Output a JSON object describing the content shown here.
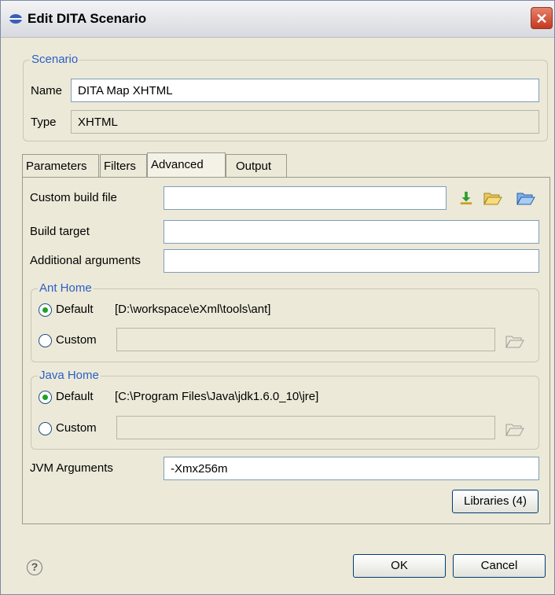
{
  "window": {
    "title": "Edit DITA Scenario"
  },
  "scenario": {
    "legend": "Scenario",
    "name_label": "Name",
    "name_value": "DITA Map XHTML",
    "type_label": "Type",
    "type_value": "XHTML"
  },
  "tabs": [
    {
      "label": "Parameters"
    },
    {
      "label": "Filters"
    },
    {
      "label": "Advanced"
    },
    {
      "label": "Output"
    }
  ],
  "advanced": {
    "custom_build_label": "Custom build file",
    "custom_build_value": "",
    "build_target_label": "Build target",
    "build_target_value": "",
    "additional_args_label": "Additional arguments",
    "additional_args_value": "",
    "ant_home": {
      "legend": "Ant Home",
      "default_label": "Default",
      "default_path": "[D:\\workspace\\eXml\\tools\\ant]",
      "custom_label": "Custom",
      "custom_value": "",
      "selected": "default"
    },
    "java_home": {
      "legend": "Java Home",
      "default_label": "Default",
      "default_path": "[C:\\Program Files\\Java\\jdk1.6.0_10\\jre]",
      "custom_label": "Custom",
      "custom_value": "",
      "selected": "default"
    },
    "jvm_label": "JVM Arguments",
    "jvm_value": "-Xmx256m",
    "libraries_button": "Libraries (4)"
  },
  "footer": {
    "help_glyph": "?",
    "ok_label": "OK",
    "cancel_label": "Cancel"
  },
  "icons": {
    "title": "dita-scenario-icon",
    "close": "close-icon",
    "insert_editor_var": "insert-variable-icon",
    "browse_local": "folder-open-icon",
    "browse_url": "folder-url-icon",
    "ant_browse": "folder-icon",
    "java_browse": "folder-icon",
    "help": "help-icon"
  },
  "colors": {
    "legend": "#2b5fc6",
    "close": "#c4391f",
    "radio_dot": "#21a121"
  }
}
